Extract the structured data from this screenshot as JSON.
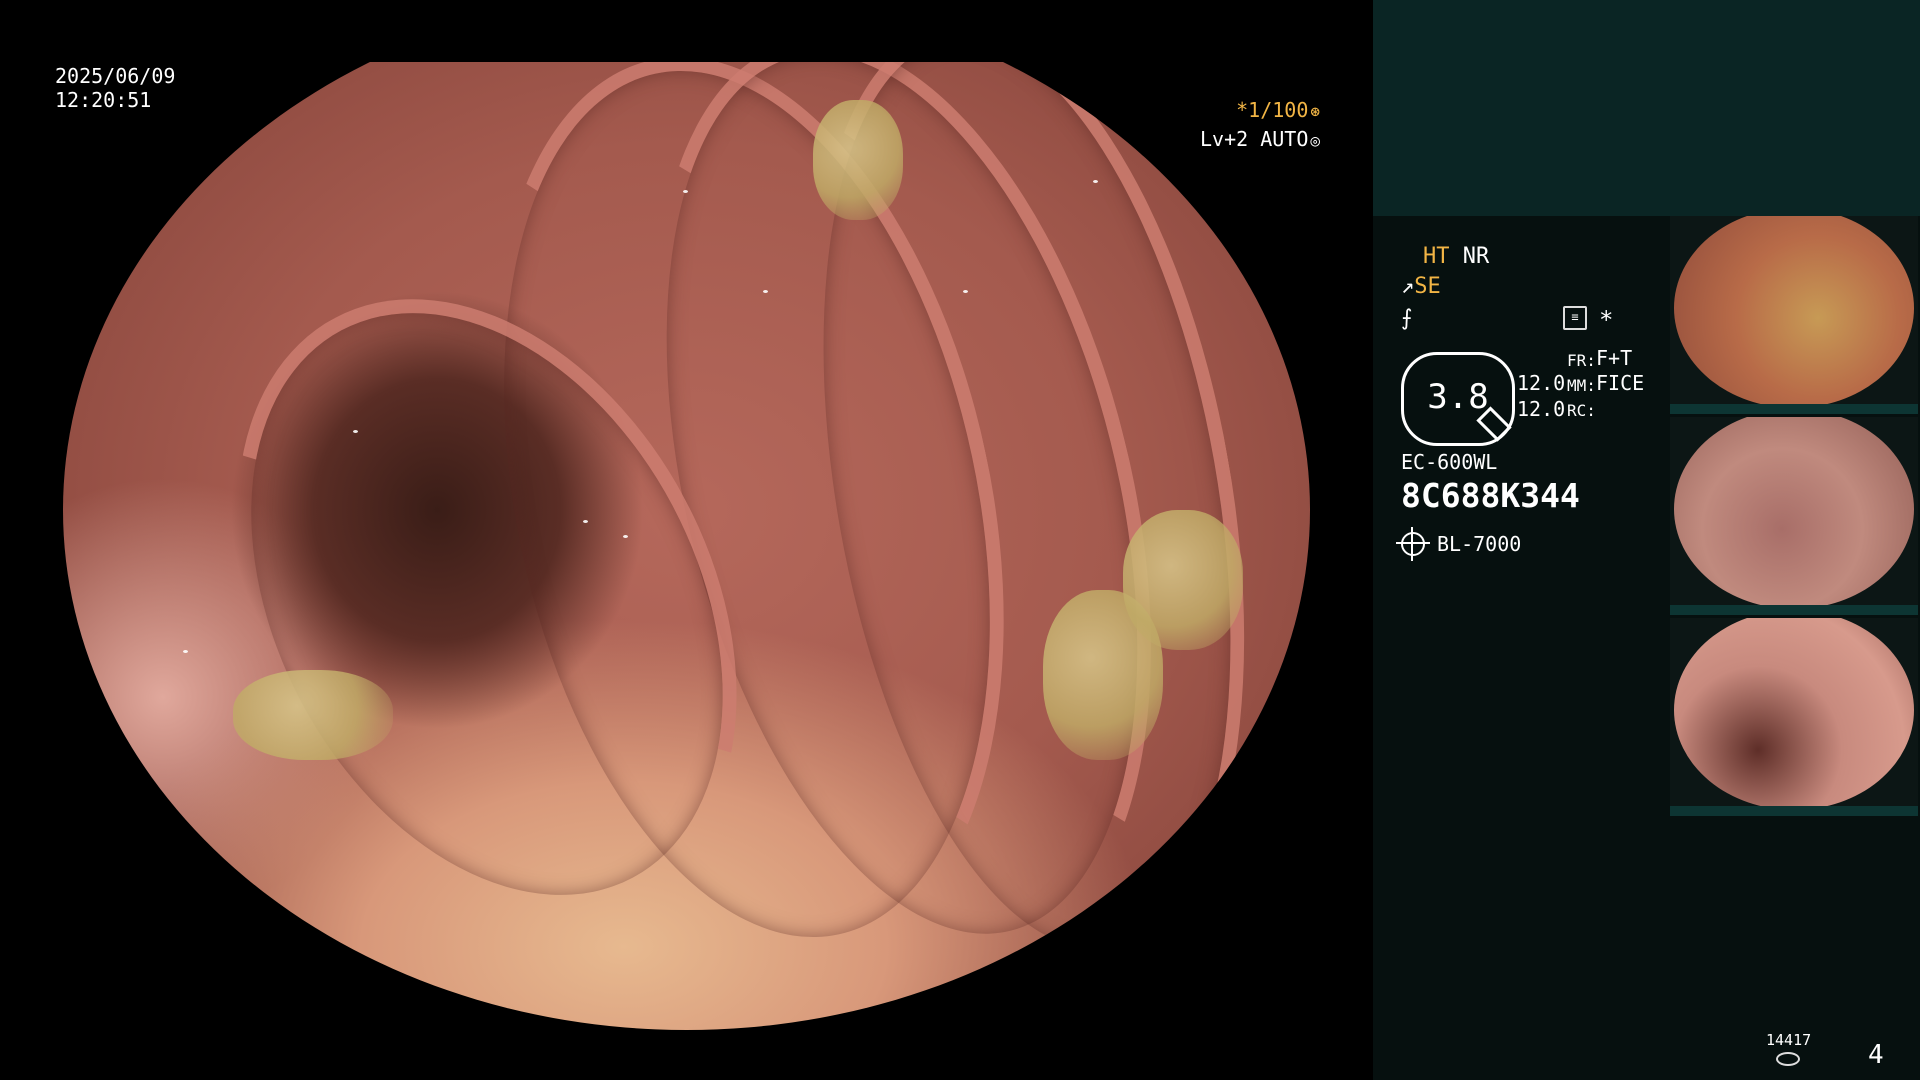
{
  "overlay": {
    "date": "2025/06/09",
    "time": "12:20:51",
    "shutter": "*1/100",
    "iris": "Lv+2 AUTO"
  },
  "sidebar": {
    "ht": "HT",
    "nr": "NR",
    "se": "SE",
    "zoom": "3.8",
    "param_val_1": "12.0",
    "param_val_2": "12.0",
    "label_fr": "FR:",
    "label_mm": "MM:",
    "label_rc": "RC:",
    "fr_value": "F+T",
    "mm_value": "FICE",
    "rc_value": "",
    "scope_model": "EC-600WL",
    "scope_serial": "8C688K344",
    "light_source": "BL-7000",
    "image_count": "14417",
    "page": "4"
  },
  "colors": {
    "accent_orange": "#f2b545",
    "panel_top": "#0a2524",
    "panel_bg": "#06100f"
  }
}
